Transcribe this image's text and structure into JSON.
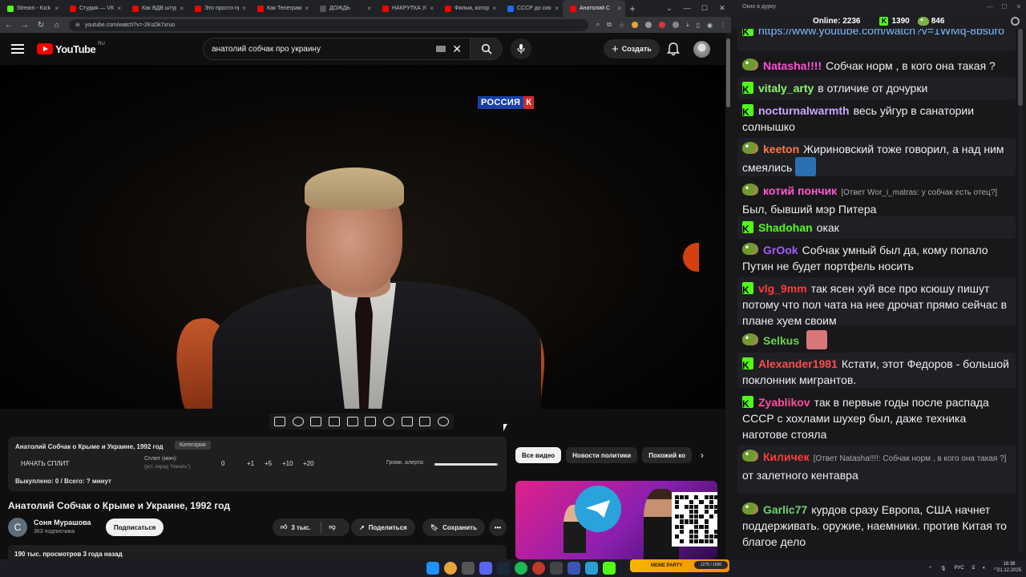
{
  "browser": {
    "tabs": [
      {
        "label": "Stream - Kick D",
        "color": "#53fc18"
      },
      {
        "label": "Студия — VK В",
        "color": "#ff0000"
      },
      {
        "label": "Как ВДВ штурм",
        "color": "#ff0000"
      },
      {
        "label": "Это просто пре",
        "color": "#ff0000"
      },
      {
        "label": "Как Телеграм-к",
        "color": "#ff0000"
      },
      {
        "label": "ДОЖДЬ",
        "color": "#555555"
      },
      {
        "label": "НАКРУТКА УБИ",
        "color": "#ff0000"
      },
      {
        "label": "Фильм, которы",
        "color": "#ff0000"
      },
      {
        "label": "СССР до сих по",
        "color": "#1e6bff"
      },
      {
        "label": "Анатолий С",
        "color": "#ff0000"
      }
    ],
    "url": "youtube.com/watch?v=-2KsDk7xruo"
  },
  "youtube": {
    "logo": "YouTube",
    "country": "RU",
    "search_query": "анатолий собчак про украину",
    "create_label": "Создать",
    "channel_watermark": {
      "text": "РОССИЯ",
      "number": "К"
    }
  },
  "split_panel": {
    "title": "Анатолий Собчак о Крыме и Украине, 1992 год",
    "tag": "Категория",
    "start": "НАЧАТЬ СПЛИТ",
    "split_label": "Сплит (мин):",
    "split_hint": "(уст. перед \"Начать\")",
    "zero": "0",
    "increments": [
      "+1",
      "+5",
      "+10",
      "+20"
    ],
    "volume_label": "Громк. алерта:",
    "volume_level": 0.98,
    "status": "Выкуплено: 0 / Всего: ? минут"
  },
  "video": {
    "title": "Анатолий Собчак о Крыме и Украине, 1992 год",
    "channel_initial": "С",
    "channel_name": "Соня Мурашова",
    "subscribers": "363 подписчика",
    "subscribe": "Подписаться",
    "likes": "3 тыс.",
    "share": "Поделиться",
    "save": "Сохранить",
    "more": "•••",
    "stats": "190 тыс. просмотров  3 года назад"
  },
  "chips": [
    "Все видео",
    "Новости политики",
    "Похожий ко"
  ],
  "chat": {
    "window_title": "Окно в дурку",
    "online_label": "Online:",
    "online": "2236",
    "kick_count": "1390",
    "pepe_count": "846",
    "messages": [
      {
        "badge": "kick",
        "user": "",
        "reply": "",
        "text": "",
        "link": "https://www.youtube.com/watch?v=1WMq-8bsuro",
        "user_color": "#53fc18",
        "alt": true
      },
      {
        "badge": "pepe",
        "user": "Natasha!!!!",
        "user_color": "#ff4fd8",
        "text": "Собчак норм , в кого она такая ?",
        "alt": false
      },
      {
        "badge": "kick",
        "user": "vitaly_arty",
        "user_color": "#8ef56b",
        "text": "в отличие от дочурки",
        "alt": true
      },
      {
        "badge": "kick",
        "user": "nocturnalwarmth",
        "user_color": "#c9a8ff",
        "text": "весь уйгур в санатории солнышко",
        "alt": false
      },
      {
        "badge": "pepe",
        "user": "keeton",
        "user_color": "#ff7a45",
        "text": "Жириновский тоже говорил, а над ним смеялись",
        "emote": "#2a6fb0",
        "alt": true
      },
      {
        "badge": "pepe",
        "user": "котий пончик",
        "user_color": "#ff5ad1",
        "reply": "[Ответ Wor_i_matras: у собчак есть отец?]",
        "text": "Был, бывший мэр Питера",
        "alt": false
      },
      {
        "badge": "kick",
        "user": "Shadohan",
        "user_color": "#53fc18",
        "text": "окак",
        "alt": true
      },
      {
        "badge": "pepe",
        "user": "GrOok",
        "user_color": "#a55cff",
        "text": "Собчак умный был да, кому попало Путин не будет портфель носить",
        "alt": false
      },
      {
        "badge": "kick",
        "user": "vlg_9mm",
        "user_color": "#ff3b3b",
        "text": "так ясен хуй все про ксюшу пишут потому что пол чата на нее дрочат прямо сейчас в плане хуем своим",
        "alt": true
      },
      {
        "badge": "pepe",
        "user": "Selkus",
        "user_color": "#6fcf4f",
        "text": "",
        "emote": "#d9767a",
        "alt": false
      },
      {
        "badge": "kick",
        "user": "Alexander1981",
        "user_color": "#ff4a4a",
        "text": "Кстати, этот Федоров - большой поклонник мигрантов.",
        "alt": true
      },
      {
        "badge": "kick",
        "user": "Zyablikov",
        "user_color": "#ff4fa0",
        "text": "так в первые годы после распада СССР с хохлами шухер был, даже техника наготове стояла",
        "alt": false
      },
      {
        "badge": "pepe",
        "user": "Киличек",
        "user_color": "#ff3b3b",
        "reply": "[Ответ Natasha!!!!: Собчак норм , в кого она такая ?]",
        "text": "от залетного кентавра",
        "alt": true
      },
      {
        "badge": "pepe",
        "user": "Garlic77",
        "user_color": "#6fd36a",
        "text": "курдов сразу Европа, США начнет поддерживать. оружие, наемники. против Китая то благое дело",
        "alt": false
      }
    ]
  },
  "taskbar": {
    "widget": "MEME PARTY",
    "widget_progress": "1275 / 1500",
    "lang": "РУС",
    "time": "16:38",
    "date": "21.12.2025"
  }
}
